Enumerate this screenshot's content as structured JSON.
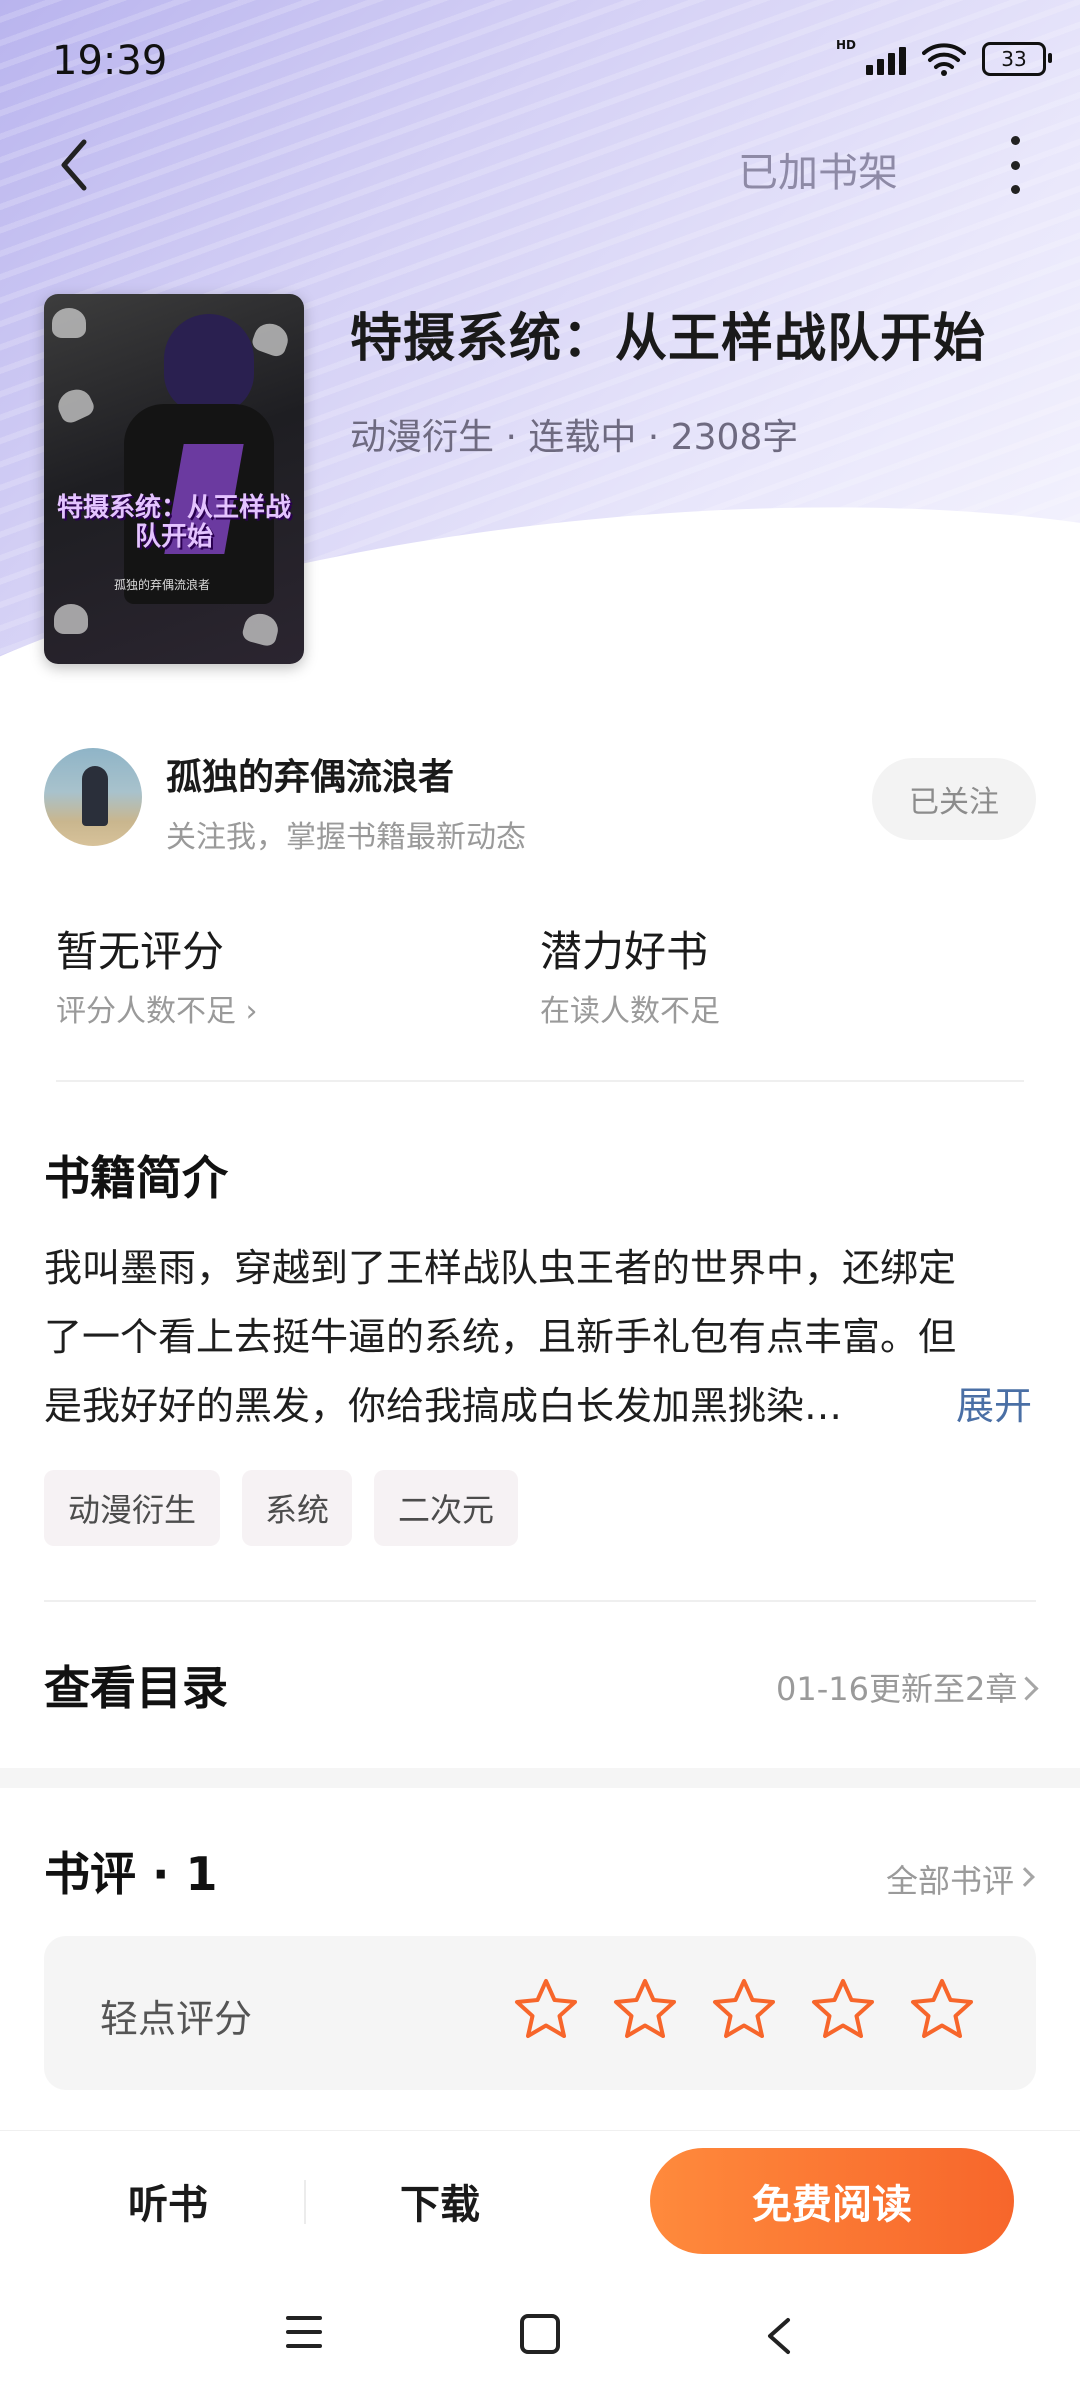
{
  "status_bar": {
    "time": "19:39",
    "network": "HD",
    "battery": "33"
  },
  "top_nav": {
    "shelf_status": "已加书架"
  },
  "book": {
    "title": "特摄系统：从王样战队开始",
    "meta": "动漫衍生 · 连载中 · 2308字",
    "cover_title": "特摄系统：从王样战队开始",
    "cover_author": "孤独的弃偶流浪者"
  },
  "author": {
    "name": "孤独的弃偶流浪者",
    "subtitle": "关注我，掌握书籍最新动态",
    "follow_label": "已关注"
  },
  "ratings": {
    "score_title": "暂无评分",
    "score_sub": "评分人数不足 ›",
    "potential_title": "潜力好书",
    "potential_sub": "在读人数不足"
  },
  "intro": {
    "heading": "书籍简介",
    "lines": [
      "我叫墨雨，穿越到了王样战队虫王者的世界中，还绑定",
      "了一个看上去挺牛逼的系统，且新手礼包有点丰富。但",
      "是我好好的黑发，你给我搞成白长发加黑挑染…"
    ],
    "expand_label": "展开",
    "tags": [
      "动漫衍生",
      "系统",
      "二次元"
    ]
  },
  "catalog": {
    "label": "查看目录",
    "update": "01-16更新至2章"
  },
  "reviews": {
    "heading": "书评 · 1",
    "all_label": "全部书评",
    "rate_label": "轻点评分",
    "star_count": 5,
    "accent_color": "#f7662b"
  },
  "bottom_bar": {
    "listen_label": "听书",
    "download_label": "下载",
    "read_label": "免费阅读"
  }
}
